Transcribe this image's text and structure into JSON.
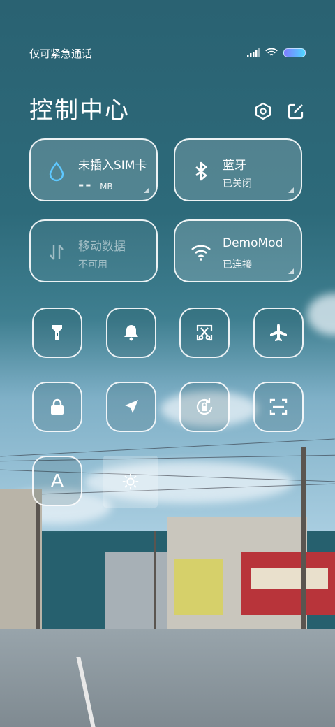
{
  "status_bar": {
    "carrier_text": "仅可紧急通话",
    "signal_icon": "signal-icon",
    "wifi_icon": "wifi-icon",
    "battery_icon": "battery-icon"
  },
  "header": {
    "title": "控制中心",
    "settings_icon": "gear-icon",
    "edit_icon": "edit-icon"
  },
  "tiles": [
    {
      "id": "sim",
      "line1": "未插入SIM卡",
      "line2": "-- MB",
      "icon": "water-drop-icon",
      "line2_prefix": "--",
      "line2_unit": "MB"
    },
    {
      "id": "bluetooth",
      "line1": "蓝牙",
      "line2": "已关闭",
      "icon": "bluetooth-icon"
    },
    {
      "id": "mobile-data",
      "line1": "移动数据",
      "line2": "不可用",
      "icon": "data-arrows-icon"
    },
    {
      "id": "wifi",
      "line1": "DemoMod",
      "line2": "已连接",
      "icon": "wifi-icon"
    }
  ],
  "toggles": [
    {
      "id": "flashlight",
      "icon": "flashlight-icon"
    },
    {
      "id": "sound",
      "icon": "bell-icon"
    },
    {
      "id": "screenshot",
      "icon": "scissors-icon"
    },
    {
      "id": "airplane",
      "icon": "airplane-icon"
    },
    {
      "id": "lock",
      "icon": "lock-icon"
    },
    {
      "id": "location",
      "icon": "location-arrow-icon"
    },
    {
      "id": "rotation-lock",
      "icon": "rotation-lock-icon"
    },
    {
      "id": "scanner",
      "icon": "scan-icon"
    },
    {
      "id": "auto-brightness",
      "icon": "letter-a-icon",
      "label": "A"
    }
  ],
  "brightness": {
    "icon": "sun-icon"
  },
  "colors": {
    "accent_blue": "#5ec8ff",
    "tile_border": "#ffffff"
  }
}
